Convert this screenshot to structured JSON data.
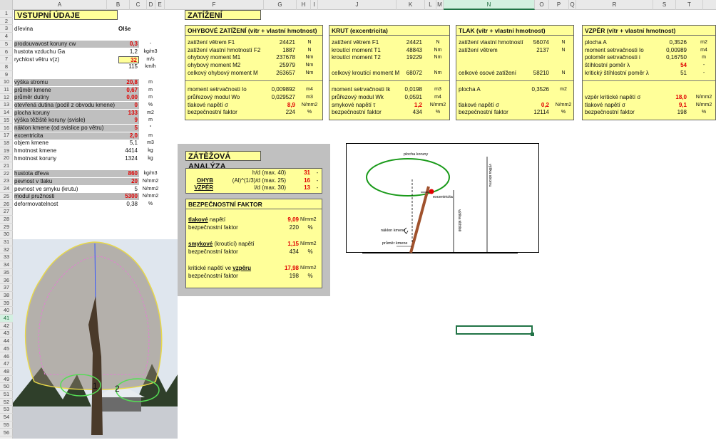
{
  "columns": [
    "A",
    "B",
    "C",
    "D",
    "E",
    "F",
    "G",
    "H",
    "I",
    "J",
    "K",
    "L",
    "M",
    "N",
    "O",
    "P",
    "Q",
    "R",
    "S",
    "T"
  ],
  "selected_column": "N",
  "rows": [
    "1",
    "2",
    "3",
    "4",
    "5",
    "6",
    "7",
    "8",
    "9",
    "10",
    "11",
    "12",
    "13",
    "14",
    "15",
    "16",
    "17",
    "18",
    "19",
    "20",
    "21",
    "22",
    "23",
    "24",
    "25",
    "26",
    "27",
    "28",
    "29",
    "30",
    "31",
    "32",
    "33",
    "34",
    "35",
    "36",
    "37",
    "38",
    "39",
    "40",
    "41",
    "42",
    "43",
    "44",
    "45",
    "46",
    "47",
    "48",
    "49",
    "50",
    "51",
    "52",
    "53",
    "54",
    "55",
    "56"
  ],
  "selected_row": "41",
  "vstup": {
    "title": "VSTUPNÍ ÚDAJE",
    "drevina_label": "dřevina",
    "drevina_value": "Olše",
    "rows": [
      {
        "label": "prodouvavost koruny cw",
        "value": "0,3",
        "unit": "-",
        "style": "gray-red"
      },
      {
        "label": "hustota vzduchu Ga",
        "value": "1,2",
        "unit": "kg/m3",
        "style": "plain"
      },
      {
        "label": "rychlost větru v(z)",
        "value": "32",
        "unit": "m/s",
        "style": "yellow-red"
      },
      {
        "label": "",
        "value": "115",
        "unit": "km/h",
        "style": "plain"
      },
      {
        "label": "",
        "value": "",
        "unit": "",
        "style": "plain"
      },
      {
        "label": "výška stromu",
        "value": "20,8",
        "unit": "m",
        "style": "gray-red"
      },
      {
        "label": "průměr kmene",
        "value": "0,67",
        "unit": "m",
        "style": "gray-red"
      },
      {
        "label": "průměr dutiny",
        "value": "0,00",
        "unit": "m",
        "style": "gray-red"
      },
      {
        "label": "otevřená dutina (podíl z obvodu kmene)",
        "value": "0",
        "unit": "%",
        "style": "gray-red"
      },
      {
        "label": "plocha koruny",
        "value": "133",
        "unit": "m2",
        "style": "gray-red"
      },
      {
        "label": "výška těžiště koruny (svisle)",
        "value": "9",
        "unit": "m",
        "style": "gray-red"
      },
      {
        "label": "náklon kmene (od svislice po větru)",
        "value": "5",
        "unit": "°",
        "style": "gray-red"
      },
      {
        "label": "excentricita",
        "value": "2,0",
        "unit": "m",
        "style": "gray-red"
      },
      {
        "label": "objem kmene",
        "value": "5,1",
        "unit": "m3",
        "style": "plain"
      },
      {
        "label": "hmotnost kmene",
        "value": "4414",
        "unit": "kg",
        "style": "plain"
      },
      {
        "label": "hmotnost koruny",
        "value": "1324",
        "unit": "kg",
        "style": "plain"
      },
      {
        "label": "",
        "value": "",
        "unit": "",
        "style": "plain"
      },
      {
        "label": "hustota dřeva",
        "value": "860",
        "unit": "kg/m3",
        "style": "gray-red"
      },
      {
        "label": "pevnost v tlaku",
        "value": "20",
        "unit": "N/mm2",
        "style": "gray-red"
      },
      {
        "label": "pevnost ve smyku (krutu)",
        "value": "5",
        "unit": "N/mm2",
        "style": "plain"
      },
      {
        "label": "modul pružnosti",
        "value": "5300",
        "unit": "N/mm2",
        "style": "gray-red"
      },
      {
        "label": "deformovatelnost",
        "value": "0,38",
        "unit": "%",
        "style": "plain"
      }
    ]
  },
  "zatizeni_title": "ZATÍŽENÍ",
  "ohyb": {
    "title": "OHYBOVÉ ZATÍŽENÍ (vítr + vlastní hmotnost)",
    "rows": [
      {
        "label": "zatížení větrem F1",
        "value": "24421",
        "unit": "N"
      },
      {
        "label": "zatížení vlastní hmotností F2",
        "value": "1887",
        "unit": "N"
      },
      {
        "label": "ohybový moment M1",
        "value": "237678",
        "unit": "Nm"
      },
      {
        "label": "ohybový moment M2",
        "value": "25979",
        "unit": "Nm"
      },
      {
        "label": "celkový ohybový moment M",
        "value": "263657",
        "unit": "Nm"
      }
    ],
    "rows2": [
      {
        "label": "moment setrvačnosti Io",
        "value": "0,009892",
        "unit": "m4"
      },
      {
        "label": "průřezový modul Wo",
        "value": "0,029527",
        "unit": "m3"
      },
      {
        "label": "tlakové napětí σ",
        "value": "8,9",
        "unit": "N/mm2",
        "red": true
      },
      {
        "label": "bezpečnostní faktor",
        "value": "224",
        "unit": "%"
      }
    ]
  },
  "krut": {
    "title": "KRUT (excentricita)",
    "rows": [
      {
        "label": "zatížení větrem F1",
        "value": "24421",
        "unit": "N"
      },
      {
        "label": "kroutící moment T1",
        "value": "48843",
        "unit": "Nm"
      },
      {
        "label": "kroutící moment T2",
        "value": "19229",
        "unit": "Nm"
      },
      {
        "label": "",
        "value": "",
        "unit": ""
      },
      {
        "label": "celkový kroutící moment M",
        "value": "68072",
        "unit": "Nm"
      }
    ],
    "rows2": [
      {
        "label": "moment setrvačnosti Ik",
        "value": "0,0198",
        "unit": "m3"
      },
      {
        "label": "průřezový modul Wk",
        "value": "0,0591",
        "unit": "m4"
      },
      {
        "label": "smykové napětí τ",
        "value": "1,2",
        "unit": "N/mm2",
        "red": true
      },
      {
        "label": "bezpečnostní faktor",
        "value": "434",
        "unit": "%"
      }
    ]
  },
  "tlak": {
    "title": "TLAK (vítr + vlastní hmotnost)",
    "rows": [
      {
        "label": "zatížení vlastní hmotností",
        "value": "56074",
        "unit": "N"
      },
      {
        "label": "zatížení větrem",
        "value": "2137",
        "unit": "N"
      },
      {
        "label": "",
        "value": "",
        "unit": ""
      },
      {
        "label": "",
        "value": "",
        "unit": ""
      },
      {
        "label": "celkové osové zatížení",
        "value": "58210",
        "unit": "N"
      }
    ],
    "rows2": [
      {
        "label": "plocha A",
        "value": "0,3526",
        "unit": "m2"
      },
      {
        "label": "",
        "value": "",
        "unit": ""
      },
      {
        "label": "tlakové napětí σ",
        "value": "0,2",
        "unit": "N/mm2",
        "red": true
      },
      {
        "label": "bezpečnostní faktor",
        "value": "12114",
        "unit": "%"
      }
    ]
  },
  "vzper": {
    "title": "VZPĚR (vítr + vlastní hmotnost)",
    "rows": [
      {
        "label": "plocha A",
        "value": "0,3526",
        "unit": "m2"
      },
      {
        "label": "moment setrvačnosti Io",
        "value": "0,00989",
        "unit": "m4"
      },
      {
        "label": "poloměr setrvačnosti i",
        "value": "0,16750",
        "unit": "m"
      },
      {
        "label": "štíhlostní poměr λ",
        "value": "54",
        "unit": "-",
        "red": true
      },
      {
        "label": "kritický štíhlostní poměr λ",
        "value": "51",
        "unit": "-"
      }
    ],
    "rows2": [
      {
        "label": "",
        "value": "",
        "unit": ""
      },
      {
        "label": "vzpěr kritické napětí σ",
        "value": "18,0",
        "unit": "N/mm2",
        "red": true
      },
      {
        "label": "tlakové napětí σ",
        "value": "9,1",
        "unit": "N/mm2",
        "red": true
      },
      {
        "label": "bezpečnostní faktor",
        "value": "198",
        "unit": "%"
      }
    ]
  },
  "analyza": {
    "title": "ZÁTĚŽOVÁ ANALÝZA",
    "rows": [
      {
        "prefix": "",
        "label": "h/d (max. 40)",
        "value": "31",
        "unit": "-"
      },
      {
        "prefix": "OHYB",
        "label": "(Al)^(1/3)/d (max. 25)",
        "value": "16",
        "unit": "-"
      },
      {
        "prefix": "VZPĚR",
        "label": "l/d (max. 30)",
        "value": "13",
        "unit": "-"
      }
    ],
    "bf_title": "BEZPEČNOSTNÍ FAKTOR",
    "blocks": [
      {
        "strong": "tlakové",
        "rest": " napětí",
        "value": "9,09",
        "unit": "N/mm2",
        "bf_label": "bezpečnostní faktor",
        "bf_value": "220",
        "bf_unit": "%"
      },
      {
        "strong": "smykové",
        "rest": " (kroutící) napětí",
        "value": "1,15",
        "unit": "N/mm2",
        "bf_label": "bezpečnostní faktor",
        "bf_value": "434",
        "bf_unit": "%"
      },
      {
        "strong": "vzpěru",
        "prefix": "kritické napětí ve ",
        "rest": "",
        "value": "17,98",
        "unit": "N/mm2",
        "bf_label": "bezpečnostní faktor",
        "bf_value": "198",
        "bf_unit": "%"
      }
    ]
  },
  "diagram": {
    "plocha": "plocha koruny",
    "vyska": "výška stromu",
    "teziste": "výška těžiště",
    "excentricita": "excentricita",
    "naklon": "náklon kmene",
    "prumer": "průměr kmene"
  },
  "tree": {
    "label1": "1",
    "label2": "2",
    "colors": {
      "sky": "#dfe6ee",
      "snow": "#e8ecf0",
      "outline_yellow": "#e8d84a",
      "outline_pink": "#e080d0",
      "outline_green": "#55dd55",
      "trunk": "#4a3a2a",
      "midline": "#3355ff"
    }
  },
  "colors": {
    "yellow": "#ffff99",
    "gray": "#bfbfbf",
    "red": "#e00000",
    "excel_green": "#217346"
  }
}
